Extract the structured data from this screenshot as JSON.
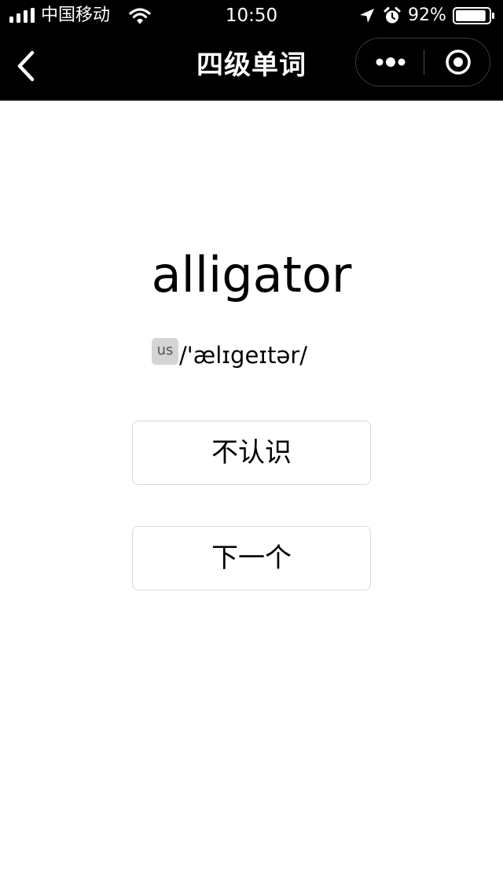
{
  "status_bar": {
    "carrier": "中国移动",
    "time": "10:50",
    "battery_percent": "92%",
    "battery_level": 0.92,
    "icons": [
      "signal-icon",
      "wifi-icon",
      "location-icon",
      "alarm-icon",
      "battery-icon"
    ]
  },
  "nav": {
    "title": "四级单词",
    "icons": [
      "back-chevron-icon",
      "more-dots-icon",
      "target-close-icon"
    ]
  },
  "card": {
    "word": "alligator",
    "accent_badge": "us",
    "phonetic": "/'ælɪgeɪtər/"
  },
  "buttons": {
    "unknown_label": "不认识",
    "next_label": "下一个"
  },
  "colors": {
    "nav_background": "#000000",
    "page_background": "#ffffff",
    "button_border": "#d9d9d9",
    "badge_background": "#d4d4d4"
  }
}
